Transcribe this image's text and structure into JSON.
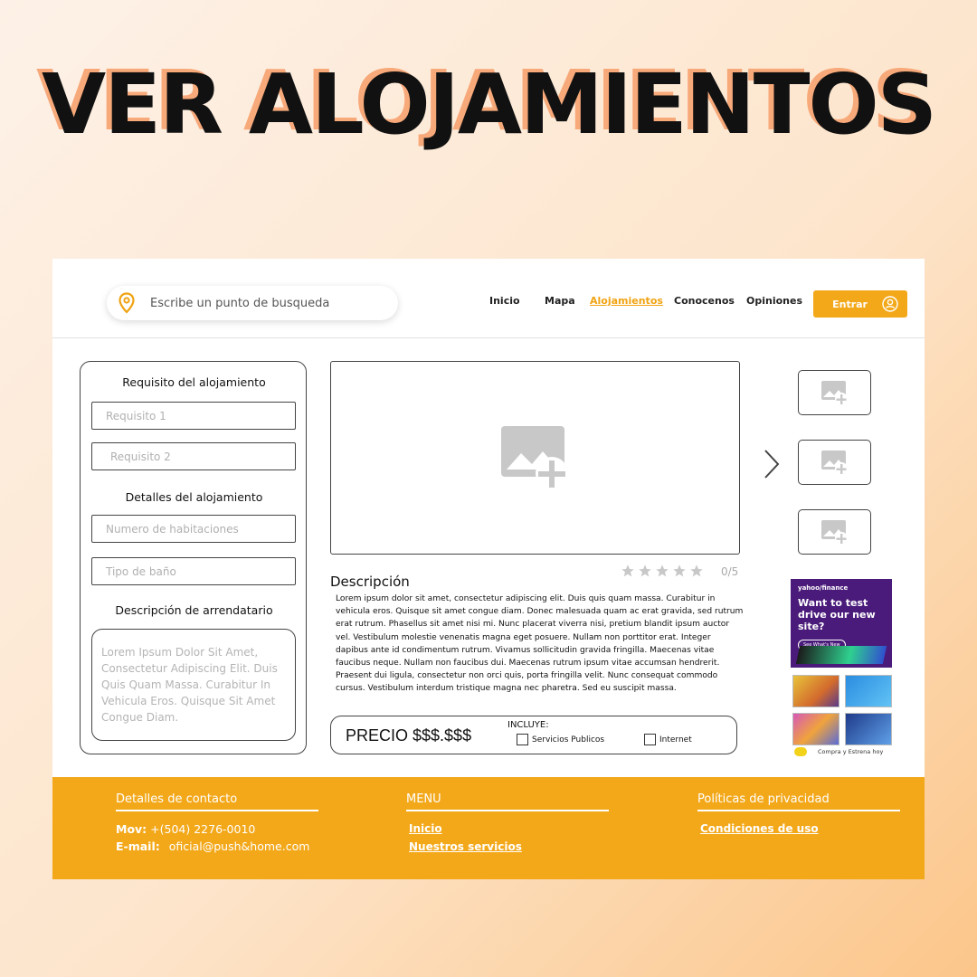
{
  "headline": "VER ALOJAMIENTOS",
  "header": {
    "search_placeholder": "Escribe un punto de busqueda",
    "nav": [
      "Inicio",
      "Mapa",
      "Alojamientos",
      "Conocenos",
      "Opiniones"
    ],
    "active_nav": "Alojamientos",
    "login_label": "Entrar"
  },
  "left_panel": {
    "requirements_title": "Requisito del alojamiento",
    "requirement1_placeholder": "Requisito 1",
    "requirement2_placeholder": "Requisito 2",
    "details_title": "Detalles del alojamiento",
    "rooms_placeholder": "Numero de habitaciones",
    "bathroom_placeholder": "Tipo de baño",
    "landlord_title": "Descripción de arrendatario",
    "landlord_text": "Lorem Ipsum Dolor Sit Amet, Consectetur Adipiscing Elit. Duis Quis Quam Massa. Curabitur In Vehicula Eros. Quisque Sit Amet Congue Diam."
  },
  "listing": {
    "description_title": "Descripción",
    "rating": "0/5",
    "description": "Lorem ipsum dolor sit amet, consectetur adipiscing elit. Duis quis quam massa. Curabitur in vehicula eros. Quisque sit amet congue diam. Donec malesuada quam ac erat gravida, sed rutrum erat rutrum. Phasellus sit amet nisi mi. Nunc placerat viverra nisi, pretium blandit ipsum auctor vel. Vestibulum molestie venenatis magna eget posuere. Nullam non porttitor erat. Integer dapibus ante id condimentum rutrum. Vivamus sollicitudin gravida fringilla. Maecenas vitae faucibus neque. Nullam non faucibus dui. Maecenas rutrum ipsum vitae accumsan hendrerit. Praesent dui ligula, consectetur non orci quis, porta fringilla velit. Nunc consequat commodo cursus. Vestibulum interdum tristique magna nec pharetra. Sed eu suscipit massa.",
    "price": "PRECIO $$$.$$$",
    "includes_label": "INCLUYE:",
    "includes": [
      "Servicios Publicos",
      "Internet"
    ]
  },
  "ads": {
    "brand": "yahoo/finance",
    "headline": "Want to test drive our new site?",
    "cta": "See What's New",
    "tagline": "Compra y Estrena hoy"
  },
  "footer": {
    "contact_title": "Detalles de contacto",
    "phone_label": "Mov:",
    "phone": "+(504) 2276-0010",
    "email_label": "E-mail:",
    "email": "oficial@push&home.com",
    "menu_title": "MENU",
    "menu_links": [
      "Inicio",
      "Nuestros servicios"
    ],
    "privacy_title": "Políticas de privacidad",
    "privacy_link": "Condiciones de uso"
  },
  "colors": {
    "accent": "#f3a81a",
    "headline_shadow": "#f7a97a",
    "text": "#111111"
  },
  "icons": [
    "location-pin-icon",
    "user-icon",
    "image-add-icon",
    "chevron-right-icon",
    "star-icon",
    "checkbox"
  ]
}
